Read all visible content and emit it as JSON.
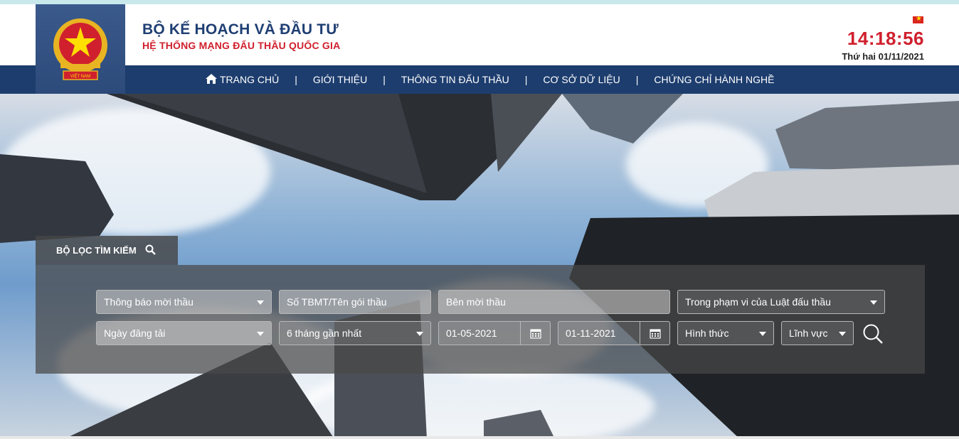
{
  "header": {
    "title": "BỘ KẾ HOẠCH VÀ ĐẦU TƯ",
    "subtitle": "HỆ THỐNG MẠNG ĐẤU THẦU QUỐC GIA",
    "clock": "14:18:56",
    "date": "Thứ hai 01/11/2021",
    "emblem_text": "VIỆT NAM"
  },
  "nav": {
    "items": [
      "TRANG CHỦ",
      "GIỚI THIỆU",
      "THÔNG TIN ĐẤU THẦU",
      "CƠ SỞ DỮ LIỆU",
      "CHỨNG CHỈ HÀNH NGHỀ"
    ],
    "separator": "|"
  },
  "filter": {
    "tab_label": "BỘ LỌC TÌM KIẾM",
    "notice_type": "Thông báo mời thầu",
    "package_placeholder": "Số TBMT/Tên gói thầu",
    "inviter_placeholder": "Bên mời thầu",
    "scope": "Trong phạm vi của Luật đấu thầu",
    "date_type": "Ngày đăng tải",
    "period": "6 tháng gần nhất",
    "date_from": "01-05-2021",
    "date_to": "01-11-2021",
    "form": "Hình thức",
    "field": "Lĩnh vực"
  },
  "colors": {
    "navy": "#1d3d6e",
    "red": "#d0202e"
  },
  "icons": [
    "home-icon",
    "search-icon",
    "calendar-icon",
    "chevron-down-icon",
    "vietnam-flag-icon",
    "national-emblem"
  ]
}
